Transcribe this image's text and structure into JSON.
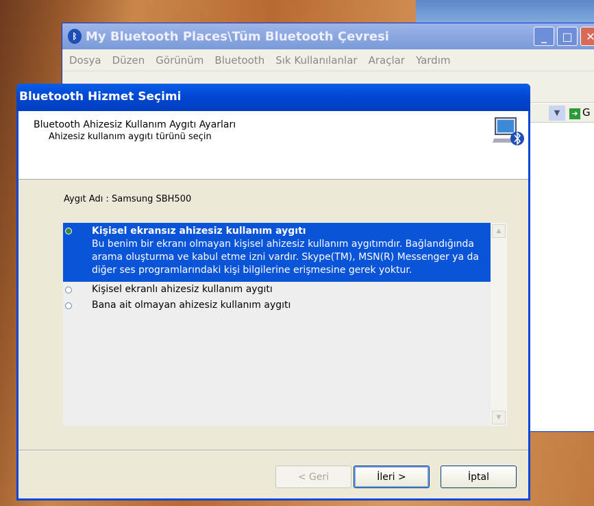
{
  "explorer": {
    "title": "My Bluetooth Places\\Tüm Bluetooth Çevresi",
    "menu": [
      "Dosya",
      "Düzen",
      "Görünüm",
      "Bluetooth",
      "Sık Kullanılanlar",
      "Araçlar",
      "Yardım"
    ],
    "go_label": "G"
  },
  "dialog": {
    "title": "Bluetooth Hizmet Seçimi",
    "heading": "Bluetooth Ahizesiz Kullanım Aygıtı Ayarları",
    "subheading": "Ahizesiz kullanım aygıtı türünü seçin",
    "device_name": "Aygıt Adı : Samsung SBH500",
    "options": [
      {
        "title": "Kişisel ekransız ahizesiz kullanım aygıtı",
        "description": "Bu benim bir ekranı olmayan kişisel ahizesiz kullanım aygıtımdır. Bağlandığında arama oluşturma ve kabul etme izni vardır. Skype(TM), MSN(R) Messenger ya da diğer ses programlarındaki kişi bilgilerine erişmesine gerek yoktur.",
        "selected": true
      },
      {
        "title": "Kişisel ekranlı ahizesiz kullanım aygıtı",
        "selected": false
      },
      {
        "title": "Bana ait olmayan ahizesiz kullanım aygıtı",
        "selected": false
      }
    ],
    "buttons": {
      "back": "< Geri",
      "next": "İleri >",
      "cancel": "İptal"
    },
    "accent": "#0a54d8"
  }
}
